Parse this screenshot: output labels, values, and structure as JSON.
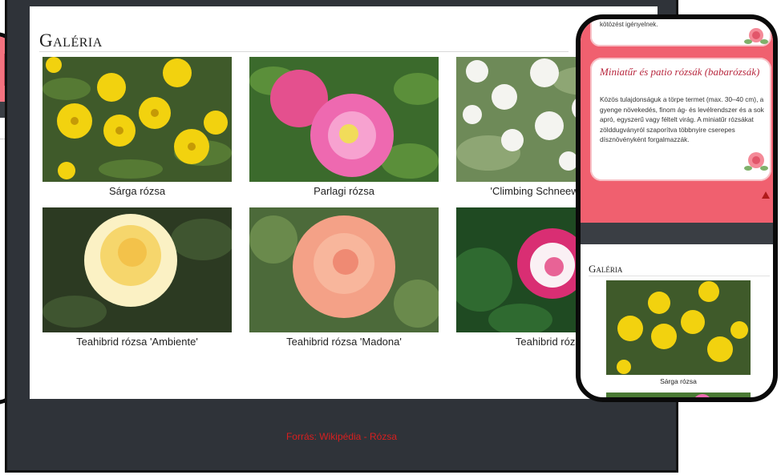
{
  "laptop": {
    "gallery_title": "Galéria",
    "gallery": [
      {
        "caption": "Sárga rózsa",
        "image": "yellow-rose-photo"
      },
      {
        "caption": "Parlagi rózsa",
        "image": "pink-rose-photo"
      },
      {
        "caption": "'Climbing Schneewittchen'",
        "image": "white-rose-photo"
      },
      {
        "caption": "Teahibrid rózsa 'Ambiente'",
        "image": "cream-rose-photo"
      },
      {
        "caption": "Teahibrid rózsa 'Madona'",
        "image": "salmon-rose-photo"
      },
      {
        "caption": "Teahibrid rózsa",
        "image": "bicolor-rose-photo"
      }
    ],
    "footer_source": "Forrás: Wikipédia - Rózsa"
  },
  "phone_right": {
    "top_card_text": "kötözést igényelnek.",
    "card_title": "Miniatűr és patio rózsák (babarózsák)",
    "card_body": "Közös tulajdonságuk a törpe termet (max. 30–40 cm), a gyenge növekedés, finom ág- és levélrendszer és a sok apró, egyszerű vagy féltelt virág. A miniatűr rózsákat zölddugványról szaporítva többnyire cserepes dísznövényként forgalmazzák.",
    "gallery_title": "Galéria",
    "gallery_caption": "Sárga rózsa",
    "scroll_top_icon": "triangle-up-icon"
  },
  "colors": {
    "page_bg": "#2f3339",
    "accent_pink": "#f0606f",
    "title_red": "#b8283f",
    "footer_red": "#d91f1f"
  }
}
